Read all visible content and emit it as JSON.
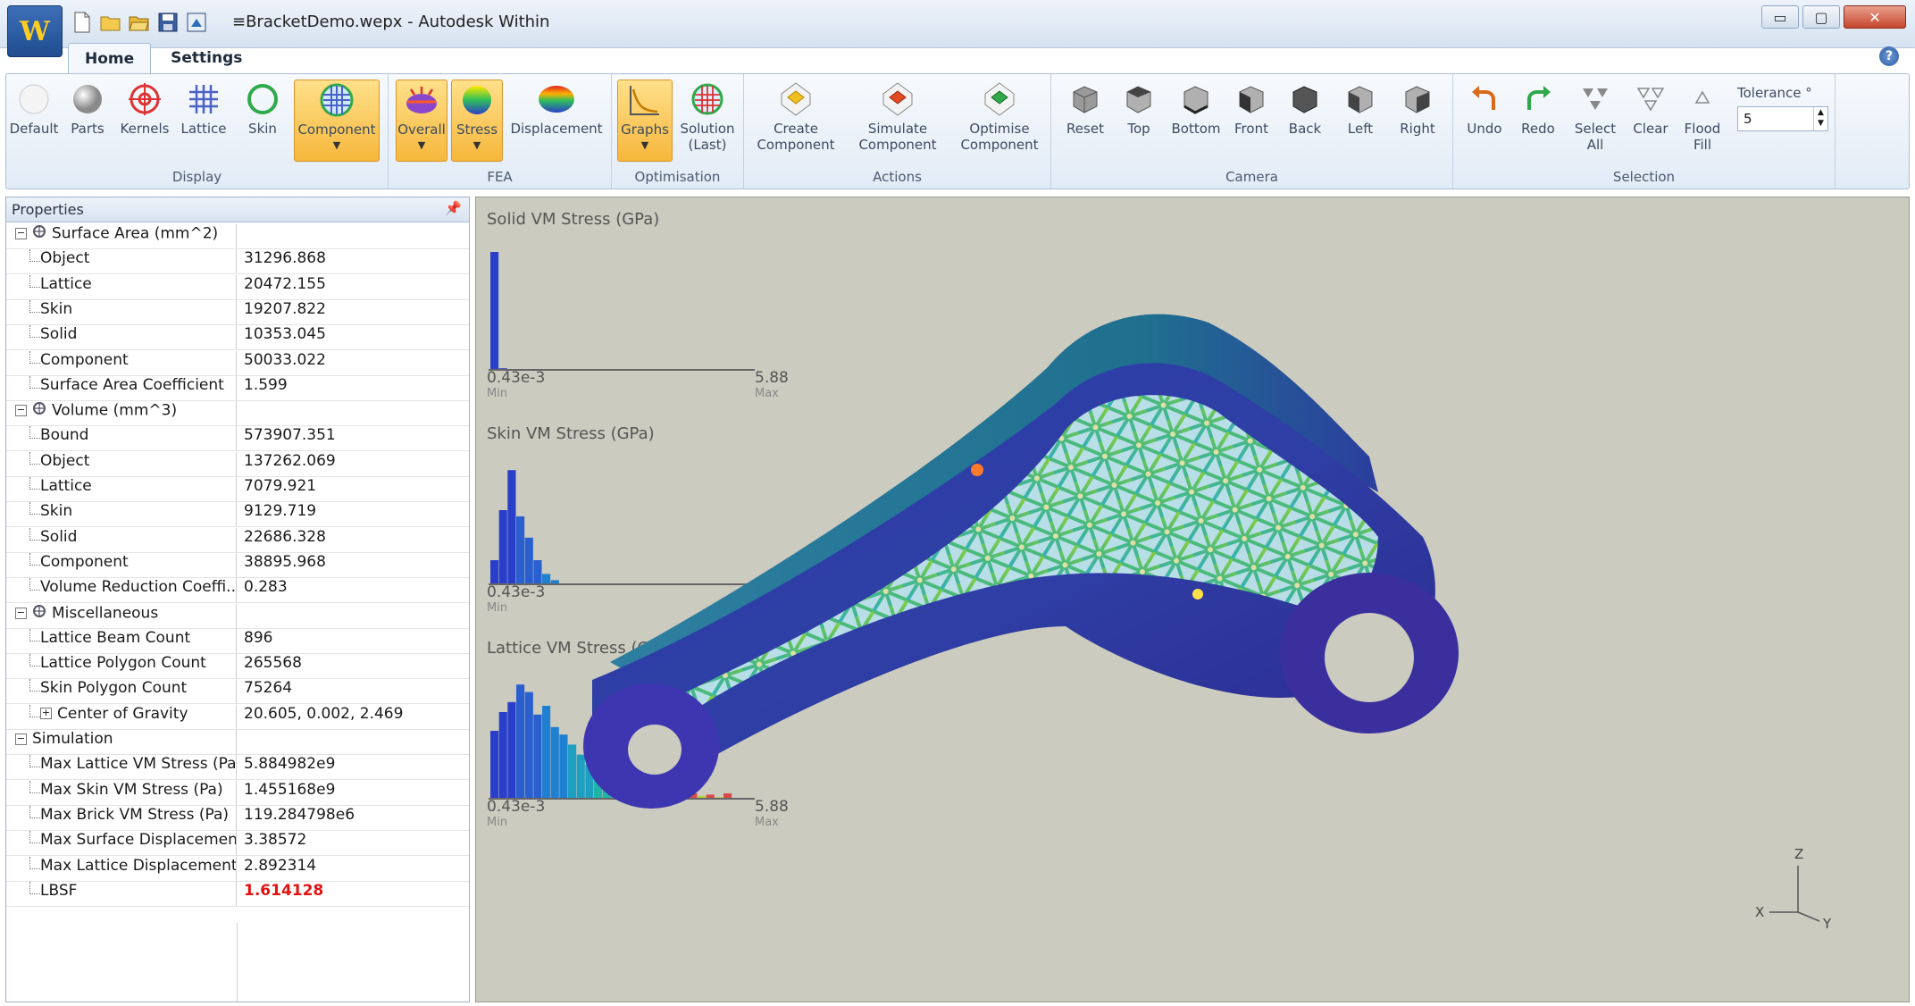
{
  "window": {
    "title": "≡BracketDemo.wepx - Autodesk Within",
    "app_button_glyph": "W",
    "quick_access_icons": [
      "new-file-icon",
      "open-folder-icon",
      "open-icon",
      "save-icon",
      "export-icon"
    ],
    "controls": {
      "minimize": "▭",
      "maximize": "▢",
      "close": "✕"
    }
  },
  "tabs": [
    {
      "label": "Home",
      "active": true
    },
    {
      "label": "Settings",
      "active": false
    }
  ],
  "ribbon": {
    "groups": {
      "display": "Display",
      "fea": "FEA",
      "optimisation": "Optimisation",
      "actions": "Actions",
      "camera": "Camera",
      "selection": "Selection"
    },
    "display": [
      "Default",
      "Parts",
      "Kernels",
      "Lattice",
      "Skin",
      "Component"
    ],
    "fea": [
      "Overall",
      "Stress",
      "Displacement"
    ],
    "optimisation": {
      "graphs": "Graphs",
      "solution_line1": "Solution",
      "solution_line2": "(Last)"
    },
    "actions": [
      {
        "line1": "Create",
        "line2": "Component"
      },
      {
        "line1": "Simulate",
        "line2": "Component"
      },
      {
        "line1": "Optimise",
        "line2": "Component"
      }
    ],
    "camera": [
      "Reset",
      "Top",
      "Bottom",
      "Front",
      "Back",
      "Left",
      "Right"
    ],
    "selection": {
      "undo": "Undo",
      "redo": "Redo",
      "select_all_line1": "Select",
      "select_all_line2": "All",
      "clear": "Clear",
      "flood_line1": "Flood",
      "flood_line2": "Fill",
      "tolerance_label": "Tolerance °",
      "tolerance_value": "5"
    },
    "accent_color": "#f6b73c"
  },
  "properties": {
    "title": "Properties",
    "rows": [
      {
        "type": "category",
        "name": "Surface Area (mm^2)",
        "value": ""
      },
      {
        "type": "item",
        "name": "Object",
        "value": "31296.868"
      },
      {
        "type": "item",
        "name": "Lattice",
        "value": "20472.155"
      },
      {
        "type": "item",
        "name": "Skin",
        "value": "19207.822"
      },
      {
        "type": "item",
        "name": "Solid",
        "value": "10353.045"
      },
      {
        "type": "item",
        "name": "Component",
        "value": "50033.022"
      },
      {
        "type": "item",
        "name": "Surface Area Coefficient",
        "value": "1.599"
      },
      {
        "type": "category",
        "name": "Volume (mm^3)",
        "value": ""
      },
      {
        "type": "item",
        "name": "Bound",
        "value": "573907.351"
      },
      {
        "type": "item",
        "name": "Object",
        "value": "137262.069"
      },
      {
        "type": "item",
        "name": "Lattice",
        "value": "7079.921"
      },
      {
        "type": "item",
        "name": "Skin",
        "value": "9129.719"
      },
      {
        "type": "item",
        "name": "Solid",
        "value": "22686.328"
      },
      {
        "type": "item",
        "name": "Component",
        "value": "38895.968"
      },
      {
        "type": "item",
        "name": "Volume Reduction Coeffi...",
        "value": "0.283"
      },
      {
        "type": "category",
        "name": "Miscellaneous",
        "value": ""
      },
      {
        "type": "item",
        "name": "Lattice Beam Count",
        "value": "896"
      },
      {
        "type": "item",
        "name": "Lattice Polygon Count",
        "value": "265568"
      },
      {
        "type": "item",
        "name": "Skin Polygon Count",
        "value": "75264"
      },
      {
        "type": "item-expand",
        "name": "Center of Gravity",
        "value": "20.605, 0.002, 2.469"
      },
      {
        "type": "category-plain",
        "name": "Simulation",
        "value": ""
      },
      {
        "type": "item",
        "name": "Max Lattice VM Stress (Pa)",
        "value": "5.884982e9"
      },
      {
        "type": "item",
        "name": "Max Skin VM Stress (Pa)",
        "value": "1.455168e9"
      },
      {
        "type": "item",
        "name": "Max Brick VM Stress (Pa)",
        "value": "119.284798e6"
      },
      {
        "type": "item",
        "name": "Max Surface Displacemen...",
        "value": "3.38572"
      },
      {
        "type": "item",
        "name": "Max Lattice Displacement ...",
        "value": "2.892314"
      },
      {
        "type": "item-highlight",
        "name": "LBSF",
        "value": "1.614128"
      }
    ]
  },
  "histograms": [
    {
      "title": "Solid VM Stress (GPa)",
      "min_value": "0.43e-3",
      "max_value": "5.88",
      "min_label": "Min",
      "max_label": "Max",
      "bins": [
        95,
        2,
        1,
        0,
        0,
        0,
        0,
        0,
        0,
        0,
        0,
        0,
        0,
        0,
        0,
        0,
        0,
        0,
        0,
        0,
        0,
        0,
        0,
        0,
        0,
        0,
        0,
        0,
        0,
        0
      ]
    },
    {
      "title": "Skin VM Stress (GPa)",
      "min_value": "0.43e-3",
      "max_value": "5.88",
      "min_label": "Min",
      "max_label": "Max",
      "bins": [
        20,
        60,
        92,
        55,
        38,
        20,
        9,
        4,
        1,
        0,
        0,
        0,
        0,
        0,
        0,
        0,
        0,
        0,
        0,
        0,
        0,
        0,
        0,
        0,
        0,
        0,
        0,
        0,
        0,
        0
      ]
    },
    {
      "title": "Lattice VM Stress (GPa)",
      "min_value": "0.43e-3",
      "max_value": "5.88",
      "min_label": "Min",
      "max_label": "Max",
      "bins": [
        55,
        70,
        78,
        92,
        86,
        68,
        75,
        58,
        52,
        44,
        36,
        28,
        20,
        15,
        10,
        8,
        6,
        4,
        3,
        6,
        2,
        4,
        2,
        5,
        3,
        4,
        2,
        5,
        1,
        0
      ]
    }
  ],
  "axes": {
    "x": "X",
    "y": "Y",
    "z": "Z"
  }
}
